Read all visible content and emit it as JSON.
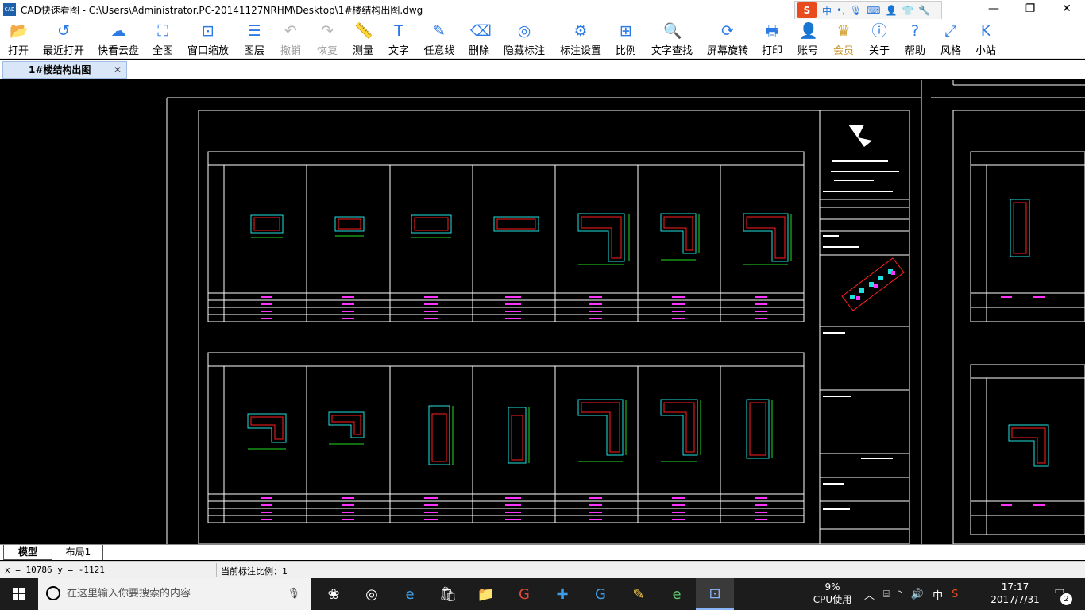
{
  "window": {
    "title": "CAD快速看图 - C:\\Users\\Administrator.PC-20141127NRHM\\Desktop\\1#楼结构出图.dwg",
    "logo_text": "CAD"
  },
  "ime": {
    "mode": "中",
    "punct": "•,",
    "s_logo": "S"
  },
  "window_controls": {
    "minimize": "—",
    "maximize": "❐",
    "close": "✕"
  },
  "toolbar": {
    "open": "打开",
    "recent": "最近打开",
    "cloud": "快看云盘",
    "full_view": "全图",
    "window_zoom": "窗口缩放",
    "layers": "图层",
    "undo": "撤销",
    "redo": "恢复",
    "measure": "测量",
    "text": "文字",
    "freeline": "任意线",
    "delete": "删除",
    "hide_annotation": "隐藏标注",
    "annotation_settings": "标注设置",
    "ratio": "比例",
    "text_search": "文字查找",
    "screen_rotate": "屏幕旋转",
    "print": "打印",
    "account": "账号",
    "member": "会员",
    "about": "关于",
    "help": "帮助",
    "style": "风格",
    "mini": "小站"
  },
  "tabs": {
    "document": "1#楼结构出图",
    "close": "✕"
  },
  "layout_tabs": {
    "model": "模型",
    "layout1": "布局1"
  },
  "status": {
    "coords": "x = 10786  y = -1121",
    "scale": "当前标注比例：1"
  },
  "taskbar": {
    "search_placeholder": "在这里输入你要搜索的内容",
    "cpu_percent": "9%",
    "cpu_label": "CPU使用",
    "ime": "中",
    "time": "17:17",
    "date": "2017/7/31",
    "notifications": "2"
  },
  "colors": {
    "accent": "#2c7be5",
    "canvas_bg": "#000000",
    "drawing_frame": "#ffffff",
    "rebar_red": "#ff2020",
    "dim_green": "#22dd22",
    "outline_cyan": "#22e0e0",
    "label_magenta": "#ff33ff"
  }
}
